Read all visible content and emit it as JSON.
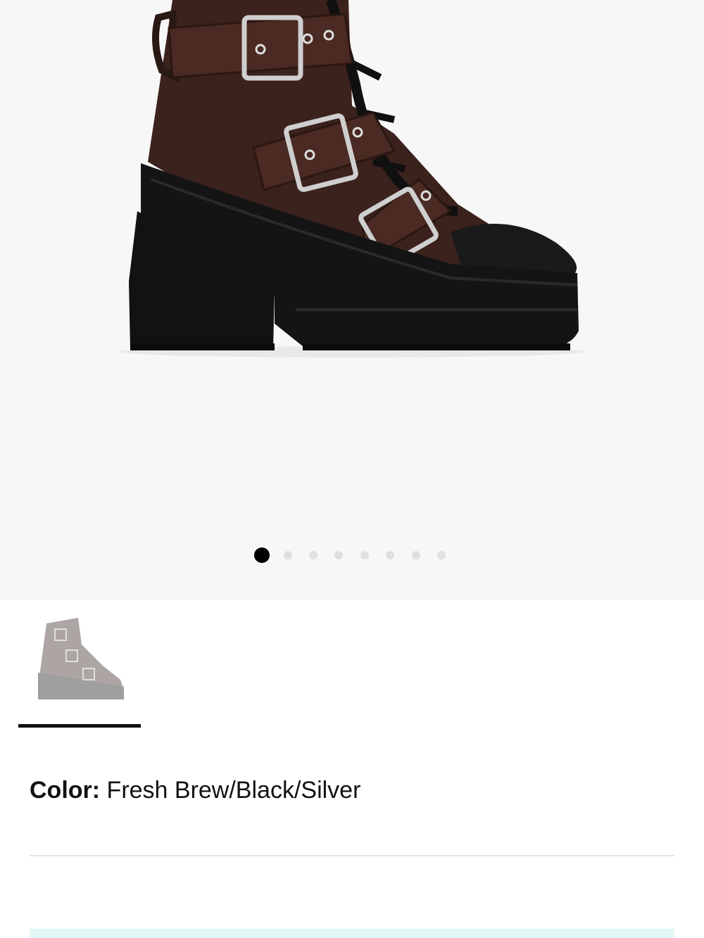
{
  "gallery": {
    "image_alt": "Fresh Brew/Black/Silver buckle platform boot",
    "slide_count": 8,
    "active_slide": 1
  },
  "thumbnail": {
    "alt": "Boot thumbnail",
    "selected": true
  },
  "color": {
    "label": "Color:",
    "value": "Fresh Brew/Black/Silver"
  },
  "colors": {
    "hero_bg": "#f7f7f7",
    "leather": "#3b221c",
    "sole": "#141414",
    "buckle": "#c9c9c9",
    "dot_active": "#000000",
    "dot_inactive": "#e0e0e0",
    "cta_strip": "#e2f7f6"
  }
}
